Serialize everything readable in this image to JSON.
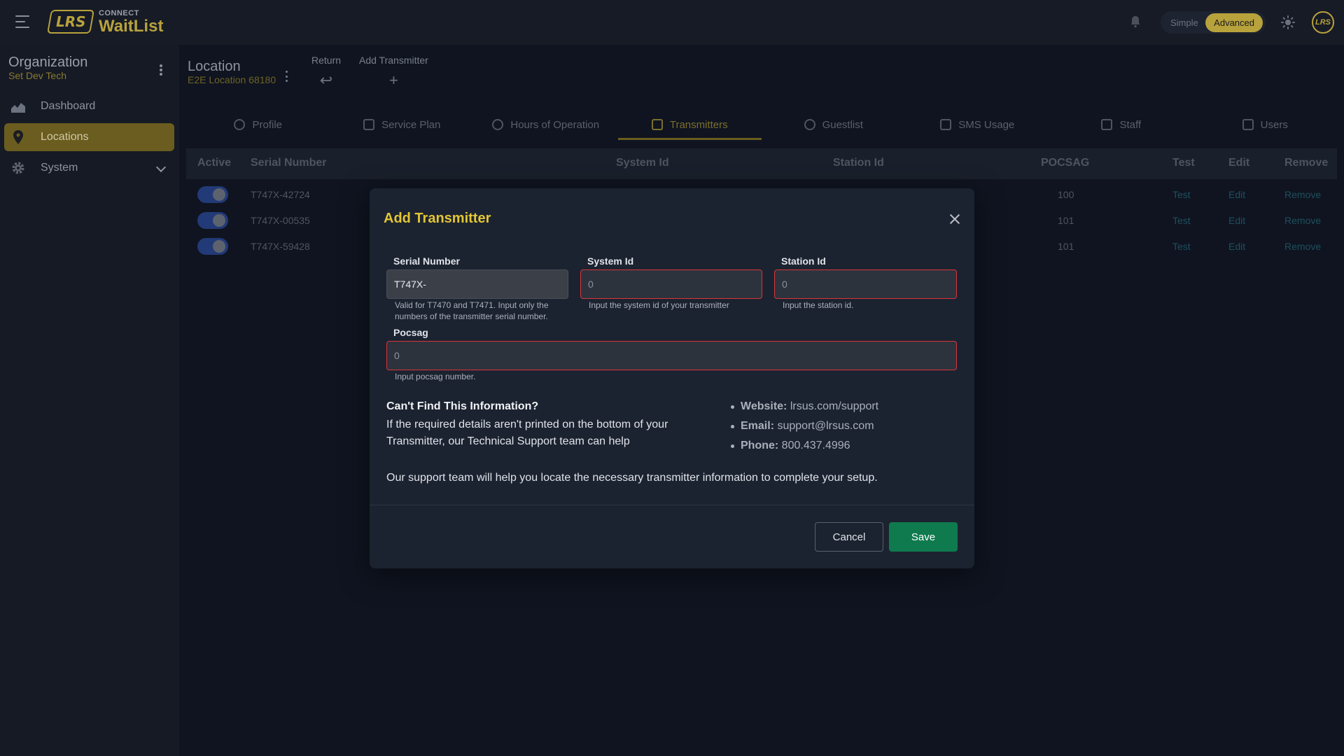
{
  "topbar": {
    "logo_text": "LRS",
    "brand_small": "CONNECT",
    "brand_name": "WaitList",
    "mode_simple": "Simple",
    "mode_advanced": "Advanced",
    "avatar_text": "LRS"
  },
  "sidebar": {
    "org_title": "Organization",
    "org_subtitle": "Set Dev Tech",
    "items": [
      {
        "label": "Dashboard",
        "icon": "chart-icon"
      },
      {
        "label": "Locations",
        "icon": "location-pin-icon",
        "active": true
      },
      {
        "label": "System",
        "icon": "gear-icon"
      }
    ]
  },
  "location": {
    "title": "Location",
    "subtitle": "E2E Location 68180",
    "return_label": "Return",
    "add_label": "Add Transmitter"
  },
  "tabs": [
    {
      "label": "Profile"
    },
    {
      "label": "Service Plan"
    },
    {
      "label": "Hours of Operation"
    },
    {
      "label": "Transmitters",
      "active": true
    },
    {
      "label": "Guestlist"
    },
    {
      "label": "SMS Usage"
    },
    {
      "label": "Staff"
    },
    {
      "label": "Users"
    }
  ],
  "table": {
    "headers": {
      "active": "Active",
      "serial": "Serial Number",
      "system_id": "System Id",
      "station_id": "Station Id",
      "pocsag": "POCSAG",
      "test": "Test",
      "edit": "Edit",
      "remove": "Remove"
    },
    "rows": [
      {
        "serial": "T747X-42724",
        "pocsag": "100",
        "test": "Test",
        "edit": "Edit",
        "remove": "Remove"
      },
      {
        "serial": "T747X-00535",
        "pocsag": "101",
        "test": "Test",
        "edit": "Edit",
        "remove": "Remove"
      },
      {
        "serial": "T747X-59428",
        "pocsag": "101",
        "test": "Test",
        "edit": "Edit",
        "remove": "Remove"
      }
    ]
  },
  "modal": {
    "title": "Add Transmitter",
    "serial_label": "Serial Number",
    "serial_value": "T747X-",
    "serial_help": "Valid for T7470 and T7471. Input only the numbers of the transmitter serial number.",
    "system_label": "System Id",
    "system_value": "0",
    "system_help": "Input the system id of your transmitter",
    "station_label": "Station Id",
    "station_value": "0",
    "station_help": "Input the station id.",
    "pocsag_label": "Pocsag",
    "pocsag_value": "0",
    "pocsag_help": "Input pocsag number.",
    "info_heading": "Can't Find This Information?",
    "info_body": "If the required details aren't printed on the bottom of your Transmitter, our Technical Support team can help",
    "info_footer": "Our support team will help you locate the necessary transmitter information to complete your setup.",
    "website_label": "Website:",
    "website_value": "lrsus.com/support",
    "email_label": "Email:",
    "email_value": "support@lrsus.com",
    "phone_label": "Phone:",
    "phone_value": "800.437.4996",
    "cancel_label": "Cancel",
    "save_label": "Save"
  },
  "colors": {
    "accent_gold": "#e2c535",
    "save_green": "#0e7a4e",
    "error_red": "#d9343c"
  }
}
